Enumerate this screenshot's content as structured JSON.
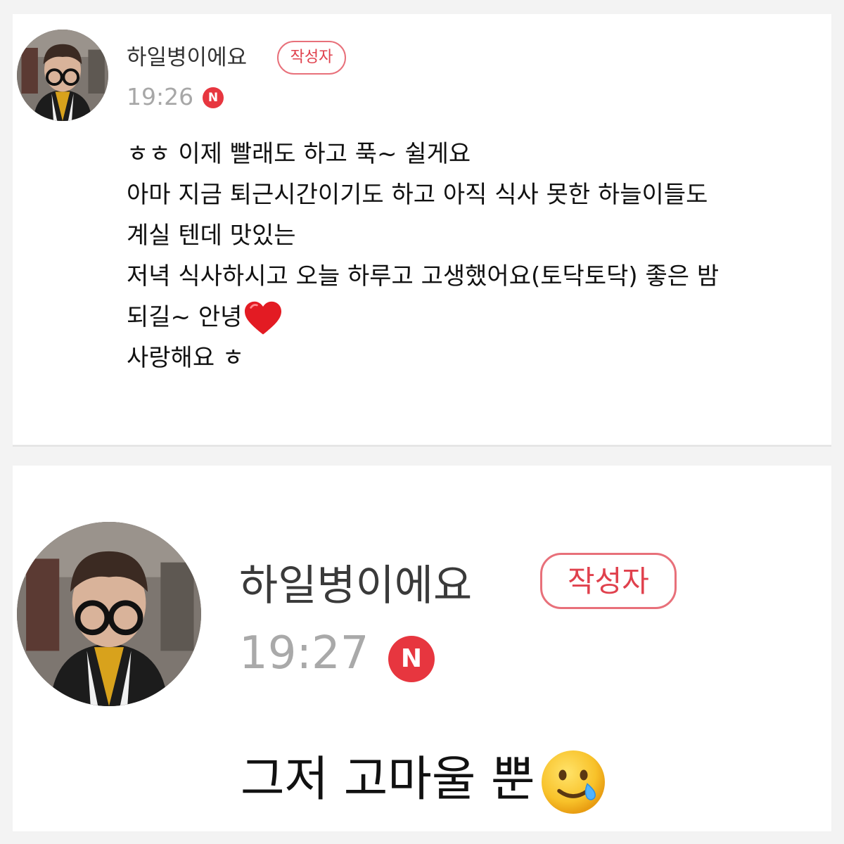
{
  "posts": [
    {
      "author": "하일병이에요",
      "badge": "작성자",
      "time": "19:26",
      "new_badge": "N",
      "lines": [
        "ㅎㅎ 이제 빨래도 하고 푹~ 쉴게요",
        "아마 지금 퇴근시간이기도 하고 아직 식사 못한 하늘이들도",
        "계실 텐데 맛있는",
        "저녁 식사하시고 오늘 하루고 고생했어요(토닥토닥) 좋은 밤",
        "되길~ 안녕",
        "사랑해요 ㅎ"
      ],
      "emoji": "red-heart"
    },
    {
      "author": "하일병이에요",
      "badge": "작성자",
      "time": "19:27",
      "new_badge": "N",
      "message": "그저 고마울 뿐",
      "emoji": "smiling-face-with-tear"
    }
  ],
  "colors": {
    "badge_red": "#e0414d",
    "new_badge_bg": "#e7363f",
    "time_gray": "#a7a7a7"
  }
}
